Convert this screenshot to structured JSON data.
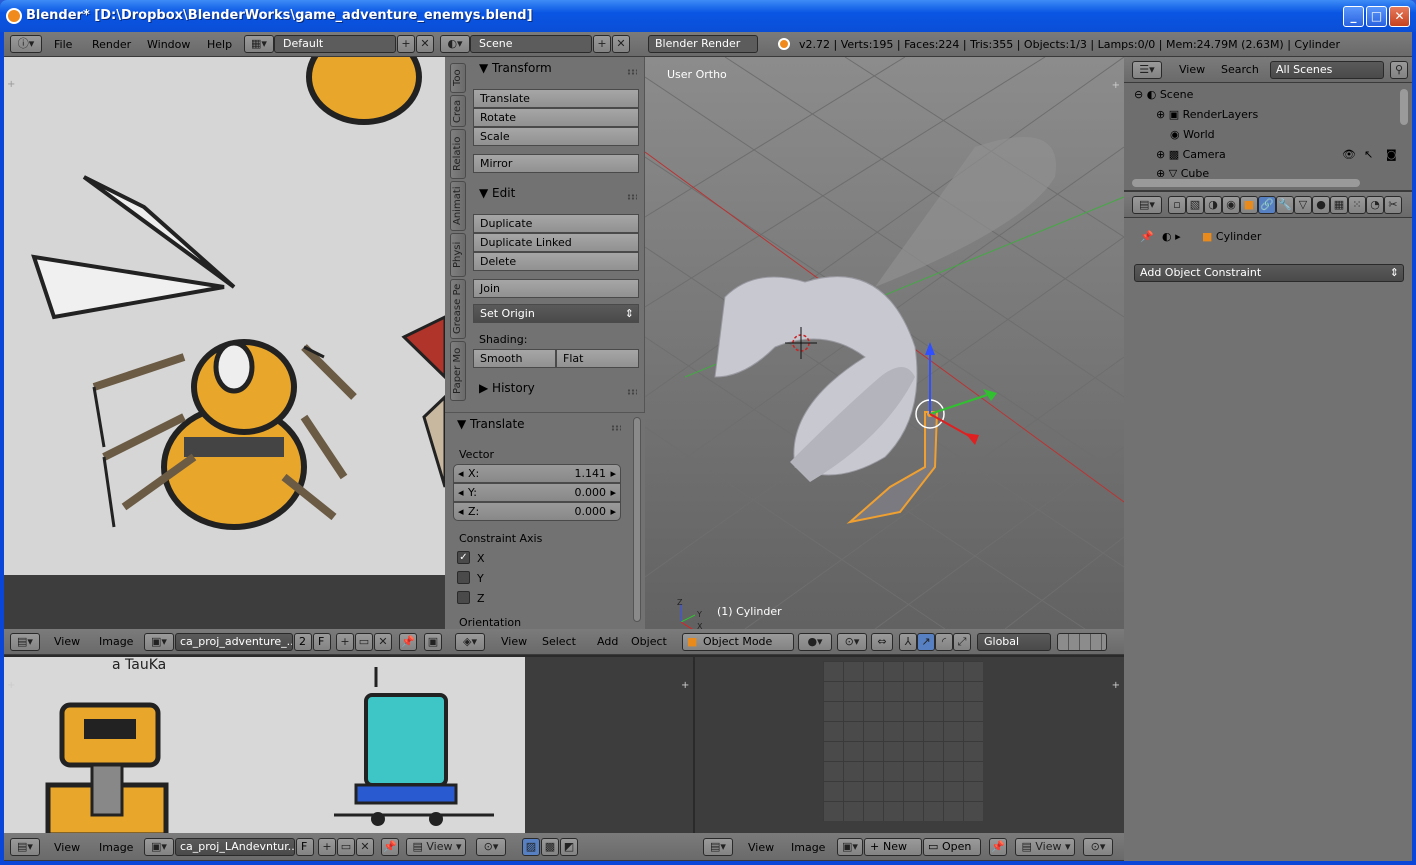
{
  "window": {
    "title": "Blender* [D:\\Dropbox\\BlenderWorks\\game_adventure_enemys.blend]",
    "controls": {
      "minimize": "_",
      "maximize": "□",
      "close": "✕"
    }
  },
  "info_header": {
    "menus": [
      "File",
      "Render",
      "Window",
      "Help"
    ],
    "layout": "Default",
    "scene": "Scene",
    "engine": "Blender Render",
    "stats": "v2.72 | Verts:195 | Faces:224 | Tris:355 | Objects:1/3 | Lamps:0/0 | Mem:24.79M (2.63M) | Cylinder"
  },
  "tool_shelf": {
    "tabs": [
      "Too",
      "Crea",
      "Relatio",
      "Animati",
      "Physi",
      "Grease Pe",
      "Paper Mo"
    ],
    "transform_header": "Transform",
    "transform_buttons": [
      "Translate",
      "Rotate",
      "Scale"
    ],
    "mirror": "Mirror",
    "edit_header": "Edit",
    "edit_buttons": [
      "Duplicate",
      "Duplicate Linked",
      "Delete"
    ],
    "join": "Join",
    "set_origin": "Set Origin",
    "shading_label": "Shading:",
    "smooth": "Smooth",
    "flat": "Flat",
    "history": "History"
  },
  "operator_panel": {
    "header": "Translate",
    "vector_label": "Vector",
    "x_label": "X:",
    "x_value": "1.141",
    "y_label": "Y:",
    "y_value": "0.000",
    "z_label": "Z:",
    "z_value": "0.000",
    "constraint_label": "Constraint Axis",
    "axes": [
      "X",
      "Y",
      "Z"
    ],
    "axes_checked": [
      true,
      false,
      false
    ],
    "orientation_label": "Orientation"
  },
  "viewport": {
    "view_name": "User Ortho",
    "object_label": "(1) Cylinder",
    "menus": [
      "View",
      "Select",
      "Add",
      "Object"
    ],
    "mode": "Object Mode",
    "orientation": "Global"
  },
  "image_editor_top": {
    "menus": [
      "View",
      "Image"
    ],
    "image_name": "ca_proj_adventure_...",
    "users": "2",
    "fake": "F"
  },
  "image_editor_bottom": {
    "menus": [
      "View",
      "Image"
    ],
    "image_name": "ca_proj_LAndevntur...",
    "fake": "F",
    "view_dropdown": "View",
    "sketch_text": "a TauKa"
  },
  "image_editor_right": {
    "menus": [
      "View",
      "Image"
    ],
    "new": "New",
    "open": "Open",
    "view_dropdown": "View"
  },
  "outliner": {
    "menus": [
      "View",
      "Search"
    ],
    "filter": "All Scenes",
    "items": [
      "Scene",
      "RenderLayers",
      "World",
      "Camera",
      "Cube"
    ]
  },
  "properties": {
    "breadcrumb_object": "Cylinder",
    "add_constraint": "Add Object Constraint"
  }
}
